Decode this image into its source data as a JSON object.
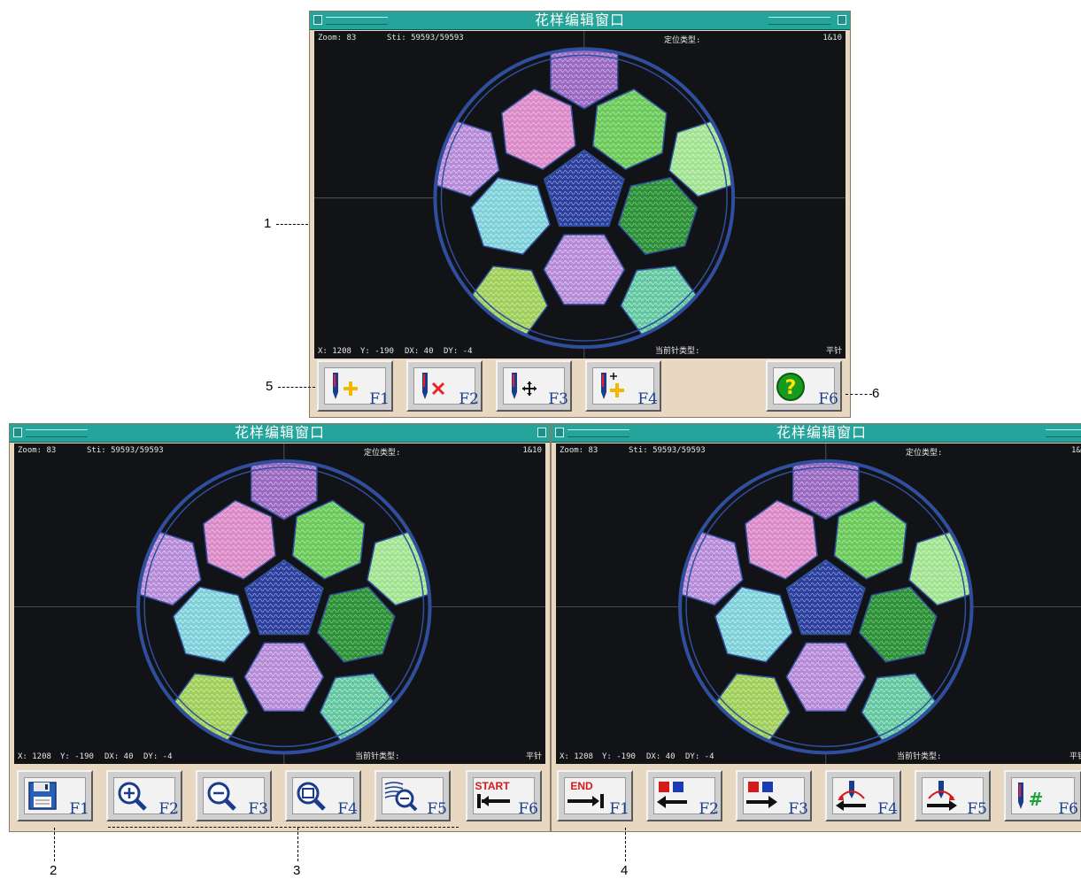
{
  "window_title": "花样编辑窗口",
  "overlay": {
    "zoom": "Zoom: 83",
    "stitches": "Sti: 59593/59593",
    "locate_type": "定位类型:",
    "ratio": "1&10",
    "x": "X: 1208",
    "y": "Y: -190",
    "dx": "DX: 40",
    "dy": "DY: -4",
    "stitch_type_label": "当前针类型:",
    "stitch_type_value": "平针"
  },
  "top_buttons": [
    {
      "key": "F1",
      "icon": "insert-stitch-icon"
    },
    {
      "key": "F2",
      "icon": "delete-stitch-icon"
    },
    {
      "key": "F3",
      "icon": "move-stitch-icon"
    },
    {
      "key": "F4",
      "icon": "add-move-stitch-icon"
    },
    {
      "key": "F6",
      "icon": "help-icon"
    }
  ],
  "left_buttons": [
    {
      "key": "F1",
      "icon": "save-disk-icon"
    },
    {
      "key": "F2",
      "icon": "zoom-in-icon"
    },
    {
      "key": "F3",
      "icon": "zoom-out-icon"
    },
    {
      "key": "F4",
      "icon": "zoom-window-icon"
    },
    {
      "key": "F5",
      "icon": "zoom-fit-icon"
    },
    {
      "key": "F6",
      "icon": "goto-start-icon",
      "label": "START"
    }
  ],
  "right_buttons": [
    {
      "key": "F1",
      "icon": "goto-end-icon",
      "label": "END"
    },
    {
      "key": "F2",
      "icon": "previous-color-icon"
    },
    {
      "key": "F3",
      "icon": "next-color-icon"
    },
    {
      "key": "F4",
      "icon": "step-back-icon"
    },
    {
      "key": "F5",
      "icon": "step-forward-icon"
    },
    {
      "key": "F6",
      "icon": "goto-stitch-number-icon"
    }
  ],
  "callouts": [
    "1",
    "2",
    "3",
    "4",
    "5",
    "6"
  ],
  "colors": {
    "titlebar": "#24a49a",
    "canvas": "#121316",
    "panel": "#e8d8c2",
    "ball_outline": "#2f4f9e"
  }
}
